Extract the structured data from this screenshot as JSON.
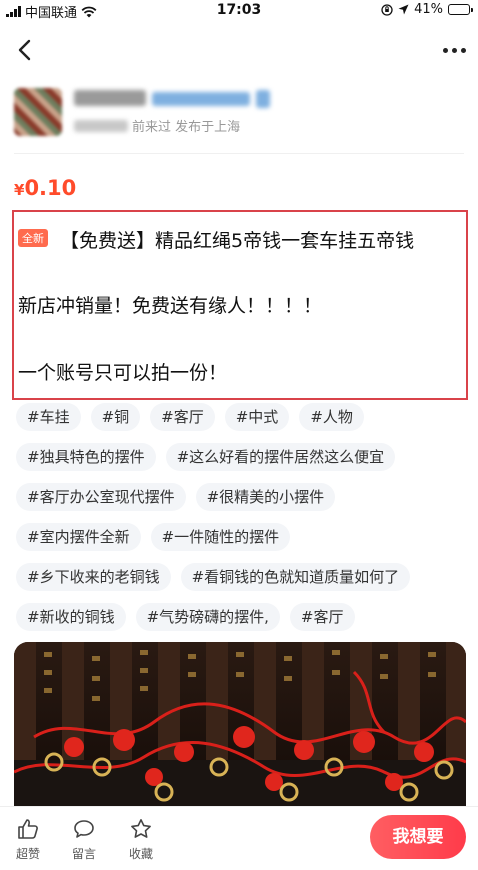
{
  "status_bar": {
    "carrier": "中国联通",
    "time": "17:03",
    "battery_label": "41%",
    "battery_fraction": 0.41
  },
  "nav": {
    "back_icon": "chevron-left-icon",
    "more_icon": "more-dots-icon"
  },
  "seller": {
    "meta_suffix": "前来过  发布于上海"
  },
  "price": {
    "currency": "¥",
    "value": "0.10",
    "color": "#ff4b2b"
  },
  "description": {
    "badge": "全新",
    "lines": [
      "【免费送】精品红绳5帝钱一套车挂五帝钱",
      "新店冲销量！免费送有缘人！！！！",
      "一个账号只可以拍一份！"
    ]
  },
  "tags": {
    "row1": [
      "#车挂",
      "#铜",
      "#客厅",
      "#中式",
      "#人物"
    ],
    "row2": [
      "#独具特色的摆件",
      "#这么好看的摆件居然这么便宜"
    ],
    "row3": [
      "#客厅办公室现代摆件",
      "#很精美的小摆件"
    ],
    "row4": [
      "#室内摆件全新",
      "#一件随性的摆件"
    ],
    "row5": [
      "#乡下收来的老铜钱",
      "#看铜钱的色就知道质量如何了"
    ],
    "row6": [
      "#新收的铜钱",
      "#气势磅礴的摆件,",
      "#客厅"
    ]
  },
  "bottom_bar": {
    "like_label": "超赞",
    "comment_label": "留言",
    "favorite_label": "收藏",
    "want_label": "我想要"
  },
  "colors": {
    "accent": "#ff4b2b",
    "highlight_border": "#d9434a",
    "tag_bg": "#f3f5f8"
  }
}
